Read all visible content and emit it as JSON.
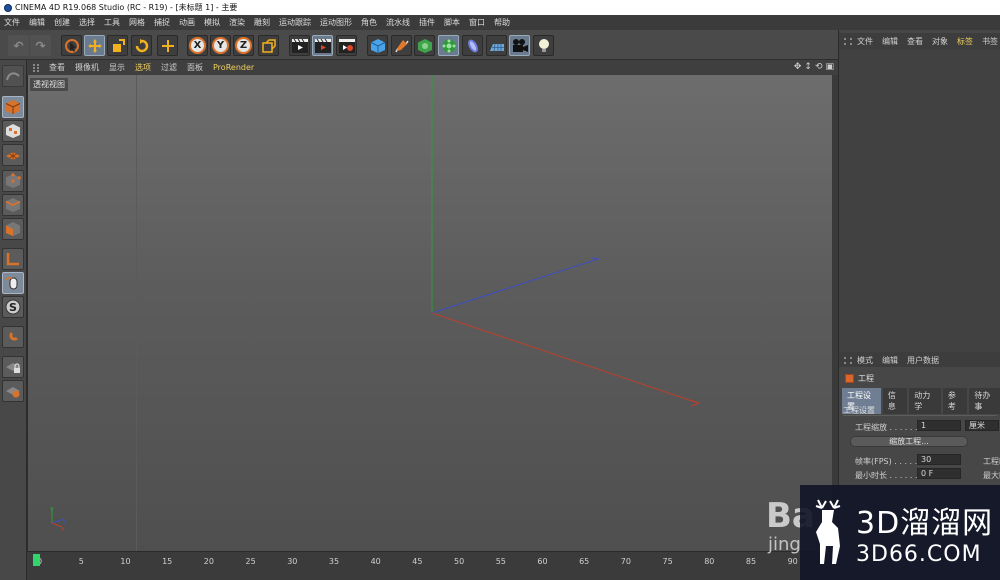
{
  "window": {
    "title": "CINEMA 4D R19.068 Studio (RC - R19) - [未标题 1] - 主要"
  },
  "menu": [
    "文件",
    "编辑",
    "创建",
    "选择",
    "工具",
    "网格",
    "捕捉",
    "动画",
    "模拟",
    "渲染",
    "雕刻",
    "运动跟踪",
    "运动图形",
    "角色",
    "流水线",
    "插件",
    "脚本",
    "窗口",
    "帮助"
  ],
  "toolbar": {
    "axis_x": "X",
    "axis_y": "Y",
    "axis_z": "Z"
  },
  "viewport": {
    "menu": [
      "查看",
      "摄像机",
      "显示",
      "选项",
      "过滤",
      "面板",
      "ProRender"
    ],
    "active_menu": "选项",
    "label": "透视视图"
  },
  "timeline": {
    "ticks": [
      "0",
      "5",
      "10",
      "15",
      "20",
      "25",
      "30",
      "35",
      "40",
      "45",
      "50",
      "55",
      "60",
      "65",
      "70",
      "75",
      "80",
      "85",
      "90"
    ]
  },
  "object_manager": {
    "tabs": [
      "文件",
      "编辑",
      "查看",
      "对象",
      "标签",
      "书签"
    ],
    "active_tab": "标签"
  },
  "attribute_manager": {
    "tabs": [
      "模式",
      "编辑",
      "用户数据"
    ],
    "object_name": "工程",
    "sub_tabs": [
      "工程设置",
      "信息",
      "动力学",
      "参考",
      "待办事"
    ],
    "active_sub_tab": "工程设置",
    "section": "工程设置",
    "scale_label": "工程缩放 . . . . . . . .",
    "scale_value": "1",
    "scale_unit": "厘米",
    "scale_button": "缩放工程...",
    "fps_label": "帧率(FPS) . . . . . . .",
    "fps_value": "30",
    "min_label": "最小时长 . . . . . . . .",
    "min_value": "0 F",
    "right_label1": "工程时",
    "right_label2": "最大时"
  },
  "watermark": {
    "baidu": "Ba",
    "baidu_sub": "jing",
    "site_cn": "3D溜溜网",
    "site_url": "3D66.COM"
  },
  "colors": {
    "accent_yellow": "#f0d060",
    "axis_x": "#b8402f",
    "axis_y": "#2f9a3a",
    "axis_z": "#3d4fc4",
    "timeline_cursor": "#2fd66a"
  }
}
